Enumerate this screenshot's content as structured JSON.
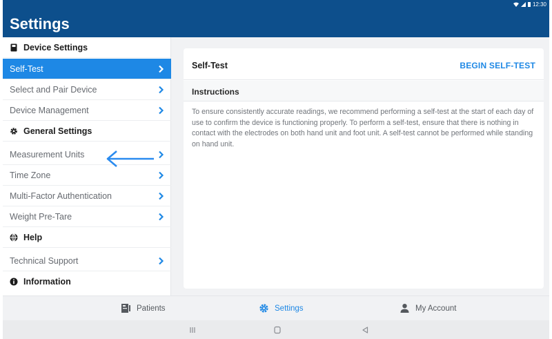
{
  "appbar": {
    "title": "Settings",
    "status_time": "12:30"
  },
  "sidebar": {
    "sections": [
      {
        "header": "Device Settings",
        "icon": "device-icon",
        "items": [
          {
            "label": "Self-Test",
            "active": true
          },
          {
            "label": "Select and Pair Device"
          },
          {
            "label": "Device Management"
          }
        ]
      },
      {
        "header": "General Settings",
        "icon": "gear-icon",
        "items": [
          {
            "label": "Measurement Units"
          },
          {
            "label": "Time Zone"
          },
          {
            "label": "Multi-Factor Authentication"
          },
          {
            "label": "Weight Pre-Tare"
          }
        ]
      },
      {
        "header": "Help",
        "icon": "globe-icon",
        "items": [
          {
            "label": "Technical Support"
          }
        ]
      },
      {
        "header": "Information",
        "icon": "info-icon",
        "items": []
      }
    ]
  },
  "content": {
    "title": "Self-Test",
    "action": "BEGIN SELF-TEST",
    "section_title": "Instructions",
    "instructions": "To ensure consistently accurate readings, we recommend performing a self-test at the start of each day of use to confirm the device is functioning properly. To perform a self-test, ensure that there is nothing in contact with the electrodes on both hand unit and foot unit. A self-test cannot be performed while standing on hand unit."
  },
  "tabbar": {
    "tabs": [
      {
        "label": "Patients",
        "icon": "patients-icon"
      },
      {
        "label": "Settings",
        "icon": "gear-icon",
        "active": true
      },
      {
        "label": "My Account",
        "icon": "person-icon"
      }
    ]
  },
  "colors": {
    "appbar": "#0d4f8c",
    "accent": "#1e88e5",
    "background": "#f1f2f4"
  }
}
